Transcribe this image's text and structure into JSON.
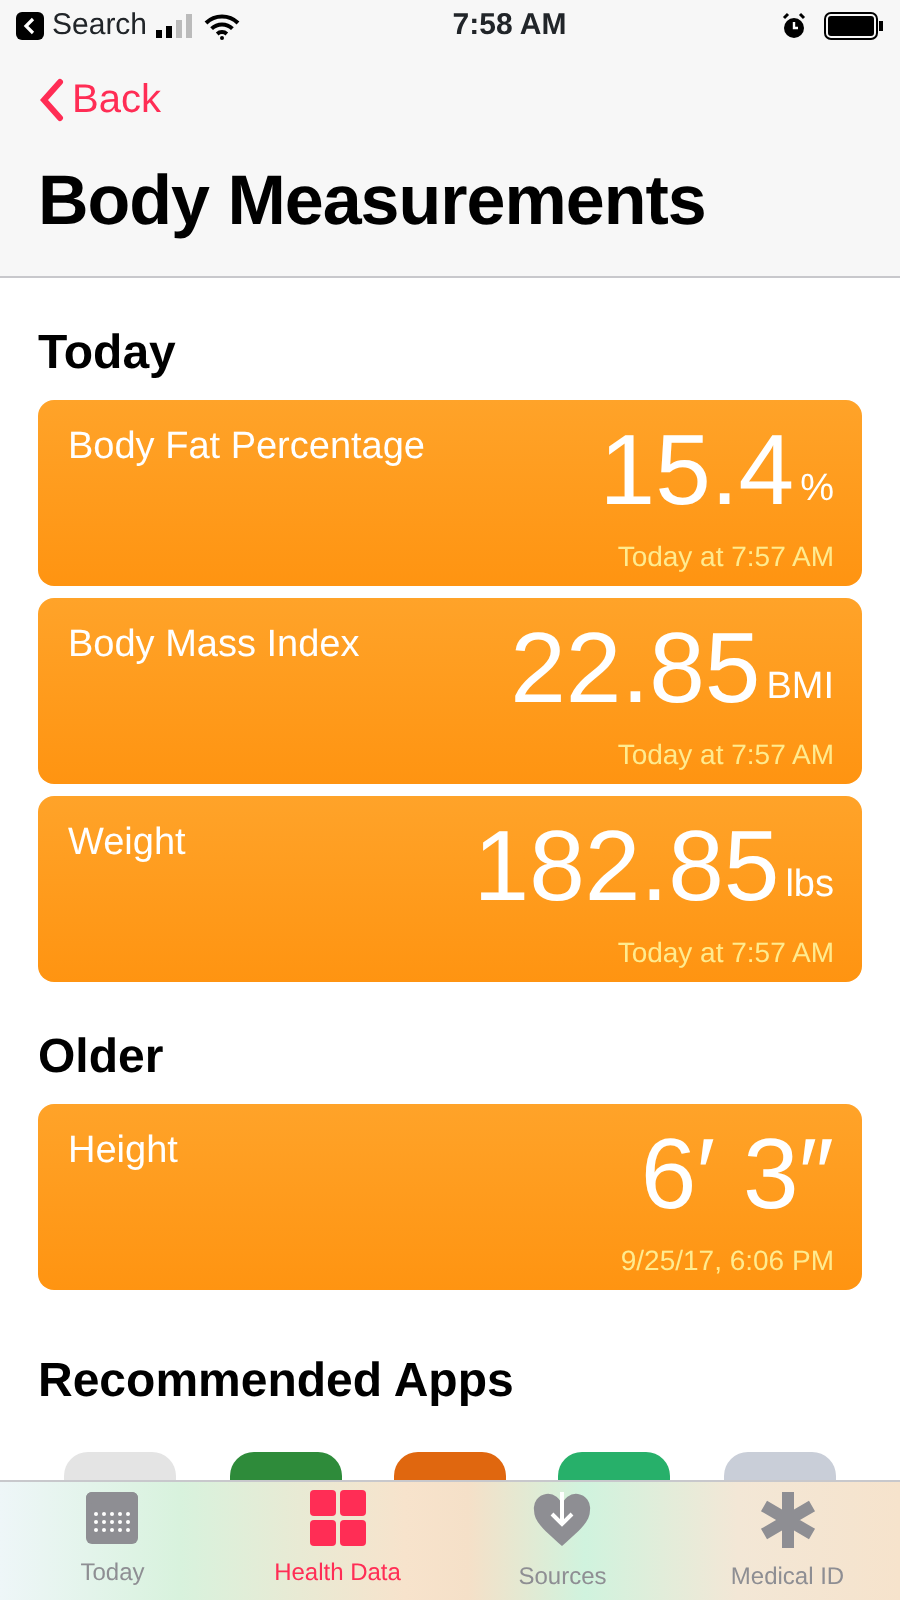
{
  "status_bar": {
    "back_app": "Search",
    "time": "7:58 AM"
  },
  "nav": {
    "back": "Back",
    "title": "Body Measurements"
  },
  "sections": [
    {
      "title": "Today",
      "items": [
        {
          "label": "Body Fat Percentage",
          "value": "15.4",
          "unit": "%",
          "time": "Today at 7:57 AM"
        },
        {
          "label": "Body Mass Index",
          "value": "22.85",
          "unit": "BMI",
          "time": "Today at 7:57 AM"
        },
        {
          "label": "Weight",
          "value": "182.85",
          "unit": "lbs",
          "time": "Today at 7:57 AM"
        }
      ]
    },
    {
      "title": "Older",
      "items": [
        {
          "label": "Height",
          "value": "6′ 3″",
          "time": "9/25/17, 6:06 PM"
        }
      ]
    }
  ],
  "recommended": {
    "title": "Recommended Apps",
    "apps": [
      {
        "color": "#e4e4e4"
      },
      {
        "color": "#2e8b3a"
      },
      {
        "color": "#e0670f"
      },
      {
        "color": "#27b06a"
      },
      {
        "color": "#c9ced8"
      }
    ]
  },
  "tabs": [
    {
      "kind": "calendar",
      "label": "Today",
      "selected": false
    },
    {
      "kind": "grid",
      "label": "Health Data",
      "selected": true
    },
    {
      "kind": "heart",
      "label": "Sources",
      "selected": false
    },
    {
      "kind": "asterisk",
      "label": "Medical ID",
      "selected": false
    }
  ]
}
